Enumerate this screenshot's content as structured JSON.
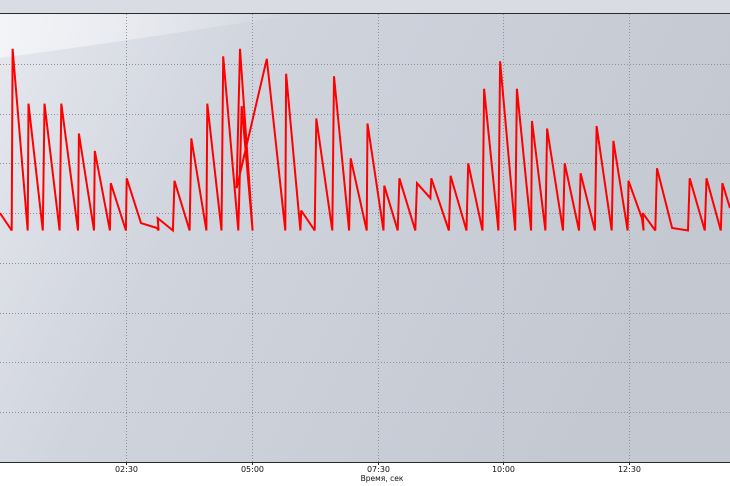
{
  "chart_data": {
    "type": "line",
    "title": "",
    "xlabel": "Время, сек",
    "ylabel": "",
    "x_unit": "seconds",
    "xlim": [
      0,
      870
    ],
    "ylim": [
      0,
      9
    ],
    "x_ticks": [
      {
        "value": 150,
        "label": "02:30"
      },
      {
        "value": 300,
        "label": "05:00"
      },
      {
        "value": 450,
        "label": "07:30"
      },
      {
        "value": 600,
        "label": "10:00"
      },
      {
        "value": 750,
        "label": "12:30"
      }
    ],
    "y_gridlines": [
      1,
      2,
      3,
      4,
      5,
      6,
      7,
      8
    ],
    "grid": true,
    "legend": "none",
    "series": [
      {
        "name": "",
        "color": "#ff0000",
        "points": [
          [
            0,
            5.0
          ],
          [
            14,
            4.65
          ],
          [
            15,
            8.3
          ],
          [
            33,
            4.65
          ],
          [
            34,
            7.2
          ],
          [
            51,
            4.65
          ],
          [
            53,
            7.2
          ],
          [
            71,
            4.65
          ],
          [
            73,
            7.2
          ],
          [
            93,
            4.65
          ],
          [
            94,
            6.6
          ],
          [
            112,
            4.65
          ],
          [
            113,
            6.25
          ],
          [
            131,
            4.65
          ],
          [
            132,
            5.6
          ],
          [
            150,
            4.65
          ],
          [
            151,
            5.7
          ],
          [
            168,
            4.8
          ],
          [
            187,
            4.7
          ],
          [
            189,
            4.65
          ],
          [
            188,
            4.9
          ],
          [
            206,
            4.65
          ],
          [
            208,
            5.65
          ],
          [
            226,
            4.65
          ],
          [
            228,
            6.5
          ],
          [
            246,
            4.65
          ],
          [
            247,
            7.2
          ],
          [
            264,
            4.65
          ],
          [
            266,
            8.15
          ],
          [
            284,
            4.65
          ],
          [
            288,
            7.15
          ],
          [
            301,
            4.65
          ],
          [
            286,
            8.3
          ],
          [
            282,
            5.5
          ],
          [
            318,
            8.1
          ],
          [
            340,
            4.65
          ],
          [
            341,
            7.8
          ],
          [
            358,
            4.65
          ],
          [
            359,
            5.05
          ],
          [
            375,
            4.65
          ],
          [
            377,
            6.9
          ],
          [
            396,
            4.65
          ],
          [
            398,
            7.75
          ],
          [
            416,
            4.65
          ],
          [
            418,
            6.1
          ],
          [
            437,
            4.65
          ],
          [
            438,
            6.8
          ],
          [
            457,
            4.65
          ],
          [
            458,
            5.55
          ],
          [
            474,
            4.65
          ],
          [
            476,
            5.7
          ],
          [
            495,
            4.65
          ],
          [
            497,
            5.6
          ],
          [
            513,
            5.3
          ],
          [
            514,
            5.7
          ],
          [
            535,
            4.65
          ],
          [
            537,
            5.75
          ],
          [
            556,
            4.65
          ],
          [
            558,
            6.0
          ],
          [
            575,
            4.65
          ],
          [
            577,
            7.5
          ],
          [
            594,
            4.65
          ],
          [
            596,
            8.05
          ],
          [
            614,
            4.65
          ],
          [
            616,
            7.5
          ],
          [
            633,
            4.65
          ],
          [
            634,
            6.85
          ],
          [
            650,
            4.65
          ],
          [
            652,
            6.7
          ],
          [
            671,
            4.65
          ],
          [
            673,
            6.0
          ],
          [
            690,
            4.65
          ],
          [
            692,
            5.8
          ],
          [
            709,
            4.65
          ],
          [
            711,
            6.75
          ],
          [
            729,
            4.65
          ],
          [
            731,
            6.45
          ],
          [
            748,
            4.65
          ],
          [
            749,
            5.65
          ],
          [
            765,
            4.9
          ],
          [
            767,
            4.65
          ],
          [
            766,
            5.0
          ],
          [
            781,
            4.65
          ],
          [
            783,
            5.9
          ],
          [
            801,
            4.7
          ],
          [
            820,
            4.65
          ],
          [
            822,
            5.7
          ],
          [
            840,
            4.65
          ],
          [
            842,
            5.7
          ],
          [
            859,
            4.65
          ],
          [
            861,
            5.6
          ],
          [
            870,
            5.1
          ]
        ]
      }
    ]
  }
}
